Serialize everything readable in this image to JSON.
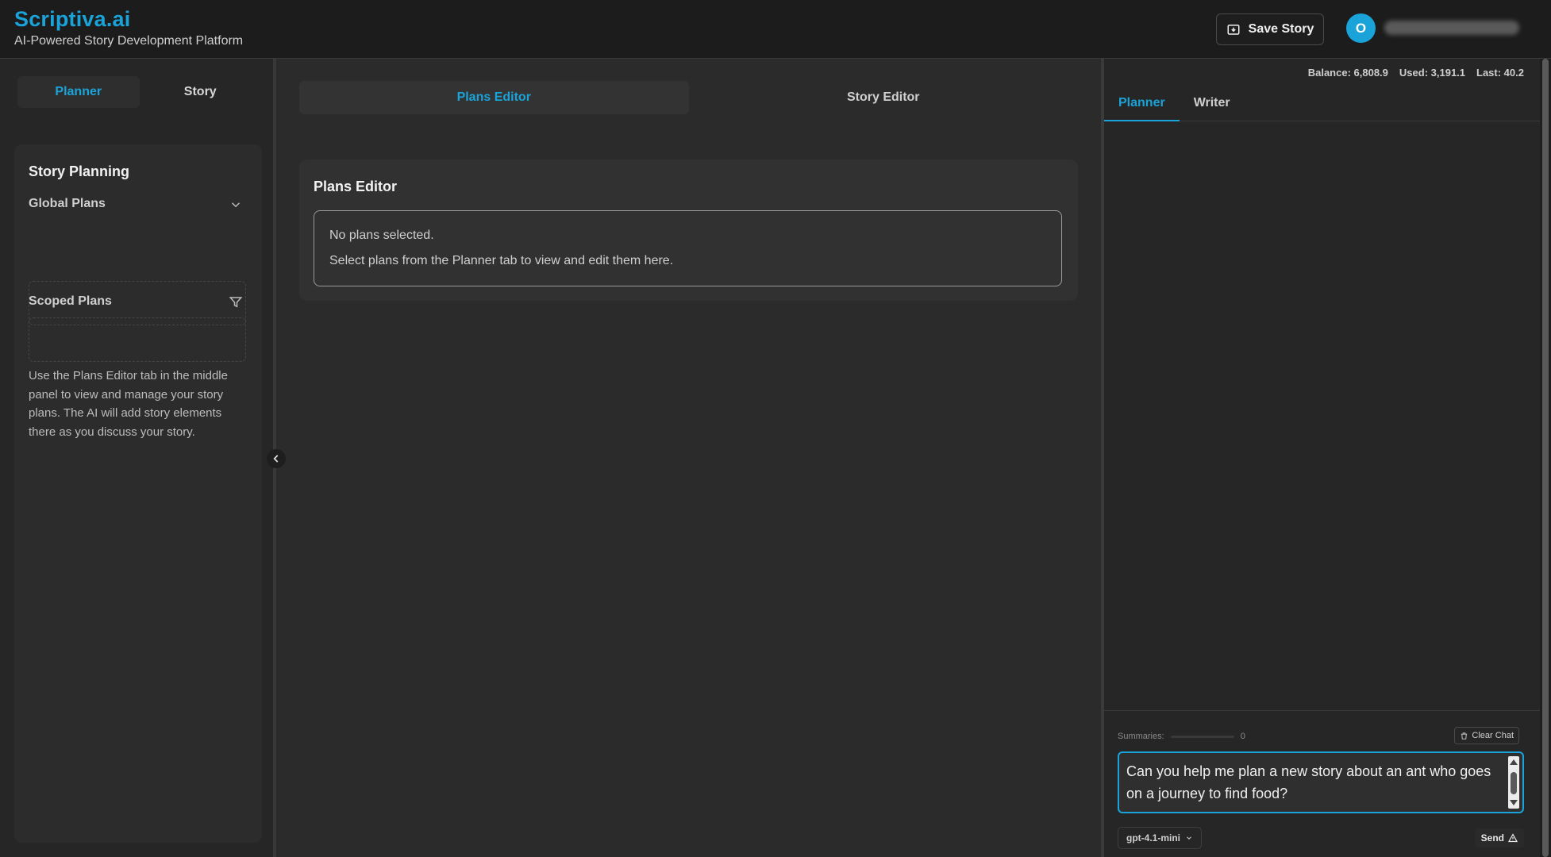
{
  "header": {
    "brand_title": "Scriptiva.ai",
    "brand_subtitle": "AI-Powered Story Development Platform",
    "save_label": "Save Story",
    "avatar_initial": "O"
  },
  "left": {
    "tabs": [
      {
        "label": "Planner",
        "active": true
      },
      {
        "label": "Story",
        "active": false
      }
    ],
    "planning_title": "Story Planning",
    "global_plans_label": "Global Plans",
    "scoped_plans_label": "Scoped Plans",
    "help_text": "Use the Plans Editor tab in the middle panel to view and manage your story plans. The AI will add story elements there as you discuss your story."
  },
  "middle": {
    "tabs": [
      {
        "label": "Plans Editor",
        "active": true
      },
      {
        "label": "Story Editor",
        "active": false
      }
    ],
    "editor_title": "Plans Editor",
    "empty_line1": "No plans selected.",
    "empty_line2": "Select plans from the Planner tab to view and edit them here."
  },
  "right": {
    "stats": {
      "balance": "Balance: 6,808.9",
      "used": "Used: 3,191.1",
      "last": "Last: 40.2"
    },
    "tabs": [
      {
        "label": "Planner",
        "active": true
      },
      {
        "label": "Writer",
        "active": false
      }
    ],
    "summaries_label": "Summaries:",
    "summaries_value": "0",
    "clear_label": "Clear Chat",
    "input_value": "Can you help me plan a new story about an ant who goes on a journey to find food?",
    "model": "gpt-4.1-mini",
    "send_label": "Send"
  },
  "colors": {
    "accent": "#1aa3d9",
    "background": "#2b2b2b",
    "header_bg": "#1c1c1c"
  }
}
